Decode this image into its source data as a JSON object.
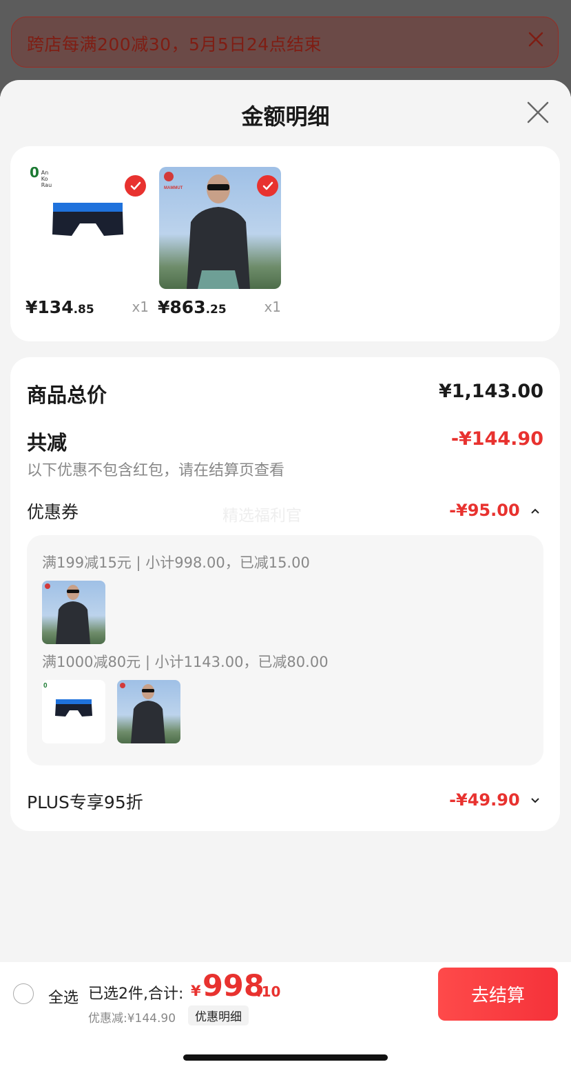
{
  "promo_banner": {
    "text": "跨店每满200减30，5月5日24点结束"
  },
  "sheet": {
    "title": "金额明细"
  },
  "products": [
    {
      "brand_logo": "0 An Ko Rau",
      "image": "boxer-briefs",
      "selected": true,
      "price_symbol": "¥",
      "price_int": "134",
      "price_dec": ".85",
      "qty": "x1"
    },
    {
      "brand_logo": "MAMMUT",
      "image": "man-in-jacket",
      "selected": true,
      "price_symbol": "¥",
      "price_int": "863",
      "price_dec": ".25",
      "qty": "x1"
    }
  ],
  "summary": {
    "goods_total_label": "商品总价",
    "goods_total_value": "¥1,143.00",
    "reduce_label": "共减",
    "reduce_value": "-¥144.90",
    "note": "以下优惠不包含红包，请在结算页查看",
    "coupon_label": "优惠券",
    "coupon_value": "-¥95.00",
    "watermark": "精选福利官",
    "coupon_tiers": [
      {
        "text": "满199减15元 | 小计998.00，已减15.00"
      },
      {
        "text": "满1000减80元 | 小计1143.00，已减80.00"
      }
    ],
    "plus_label": "PLUS专享95折",
    "plus_value": "-¥49.90"
  },
  "bottom_bar": {
    "select_all": "全选",
    "selected_text": "已选2件,合计:",
    "total_symbol": "¥",
    "total_int": "998",
    "total_dec": ".10",
    "discount_text": "优惠减:¥144.90",
    "detail_chip": "优惠明细",
    "checkout": "去结算"
  },
  "colors": {
    "accent": "#e8322f",
    "checkout_btn": "#f5323a"
  }
}
